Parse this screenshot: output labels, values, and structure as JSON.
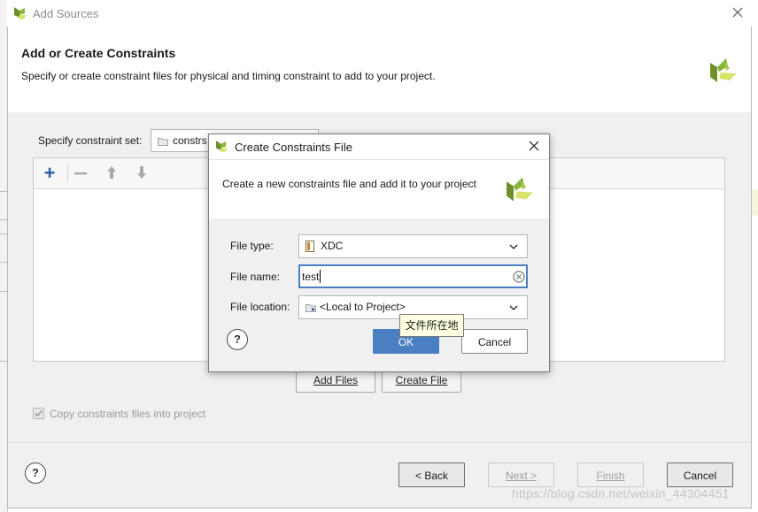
{
  "window": {
    "title": "Add Sources",
    "header_title": "Add or Create Constraints",
    "header_desc": "Specify or create constraint files for physical and timing constraint to add to your project.",
    "constraint_set_label": "Specify constraint set:",
    "constraint_set_value": "constrs",
    "add_files_label": "Add Files",
    "create_file_label": "Create File",
    "copy_checkbox_label": "Copy constraints files into project",
    "copy_checked": true,
    "footer": {
      "help": "?",
      "back": "< Back",
      "next": "Next >",
      "finish": "Finish",
      "cancel": "Cancel"
    }
  },
  "dialog": {
    "title": "Create Constraints File",
    "desc": "Create a new constraints file and add it to your project",
    "file_type_label": "File type:",
    "file_type_value": "XDC",
    "file_name_label": "File name:",
    "file_name_value": "test",
    "file_location_label": "File location:",
    "file_location_value": "<Local to Project>",
    "tooltip": "文件所在地",
    "ok": "OK",
    "cancel": "Cancel",
    "help": "?"
  },
  "watermark": "https://blog.csdn.net/weixin_44304451",
  "colors": {
    "accent_blue": "#4a7fc1",
    "logo_green": "#8ab43e",
    "logo_dark": "#6f8f2a",
    "logo_yellow": "#d7e36b"
  }
}
